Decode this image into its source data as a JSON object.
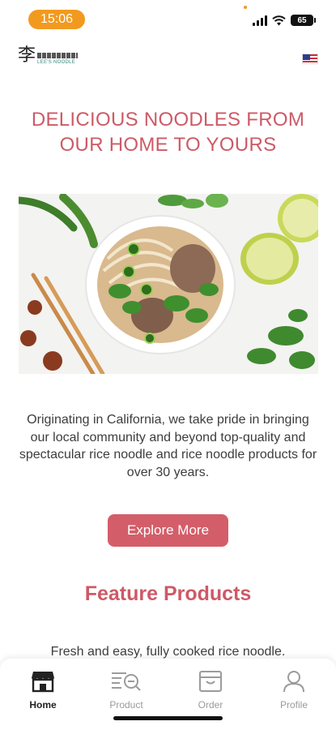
{
  "status_bar": {
    "time": "15:06",
    "battery": "65"
  },
  "header": {
    "logo_char": "李",
    "logo_text": "LEE'S NOODLE"
  },
  "hero": {
    "title": "DELICIOUS NOODLES FROM OUR HOME TO YOURS"
  },
  "intro": {
    "text": "Originating in California, we take pride in bringing our local community and beyond top-quality and spectacular rice noodle and rice noodle products for over 30 years."
  },
  "explore_button": {
    "label": "Explore More"
  },
  "feature": {
    "title": "Feature Products",
    "description": "Fresh and easy, fully cooked rice noodle."
  },
  "nav": {
    "items": [
      {
        "label": "Home",
        "icon": "store-icon",
        "active": true
      },
      {
        "label": "Product",
        "icon": "product-search-icon",
        "active": false
      },
      {
        "label": "Order",
        "icon": "order-box-icon",
        "active": false
      },
      {
        "label": "Profile",
        "icon": "person-icon",
        "active": false
      }
    ]
  },
  "colors": {
    "accent": "#cd5a66",
    "button": "#d35e69",
    "time_pill": "#f29a1f"
  }
}
